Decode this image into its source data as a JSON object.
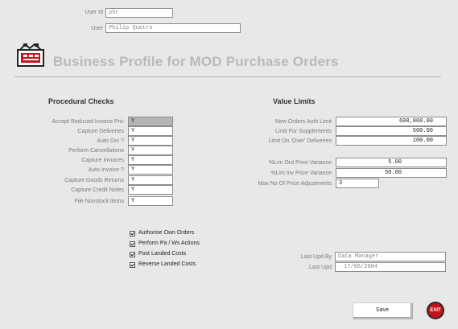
{
  "user": {
    "user_id_label": "User Id",
    "user_id_value": "phr",
    "user_label": "User",
    "user_value": "Philip Quatro"
  },
  "page_title": "Business Profile for MOD Purchase Orders",
  "procedural_checks": {
    "heading": "Procedural Checks",
    "rows": [
      {
        "label": "Accept Reduced Invoice Pric",
        "value": "Y"
      },
      {
        "label": "Capture Deliveries",
        "value": "Y"
      },
      {
        "label": "Auto Grv ?",
        "value": "Y"
      },
      {
        "label": "Perform Cancellations",
        "value": "Y"
      },
      {
        "label": "Capture Invoices",
        "value": "Y"
      },
      {
        "label": "Auto Invoice ?",
        "value": "Y"
      },
      {
        "label": "Capture Goods Returns",
        "value": "Y"
      },
      {
        "label": "Capture Credit Notes",
        "value": "Y"
      },
      {
        "label": "File Nonstock Items",
        "value": "Y"
      }
    ]
  },
  "value_limits": {
    "heading": "Value Limits",
    "group1": [
      {
        "label": "New Orders Auth Limit",
        "value": "600,000.00"
      },
      {
        "label": "Limit For Supplements",
        "value": "500.00"
      },
      {
        "label": "Limit On 'Over' Deliveries",
        "value": "100.00"
      }
    ],
    "group2": [
      {
        "label": "%Lim Ord Price Variance",
        "value": "5.00"
      },
      {
        "label": "%Lim Inv Price Variance",
        "value": "50.00"
      }
    ],
    "max_adjust": {
      "label": "Max No Of Price Adjustments",
      "value": "3"
    }
  },
  "checkboxes": [
    {
      "label": "Authorise Own Orders",
      "checked": true
    },
    {
      "label": "Perform Pa / Ws Actions",
      "checked": true
    },
    {
      "label": "Post Landed Costs",
      "checked": true
    },
    {
      "label": "Reverse Landed Costs",
      "checked": true
    }
  ],
  "last_update": {
    "by_label": "Last Upd By",
    "by_value": "Data Manager",
    "date_label": "Last Upd",
    "date_value": "17/06/2004"
  },
  "buttons": {
    "save": "Save",
    "exit": "EXIT"
  }
}
